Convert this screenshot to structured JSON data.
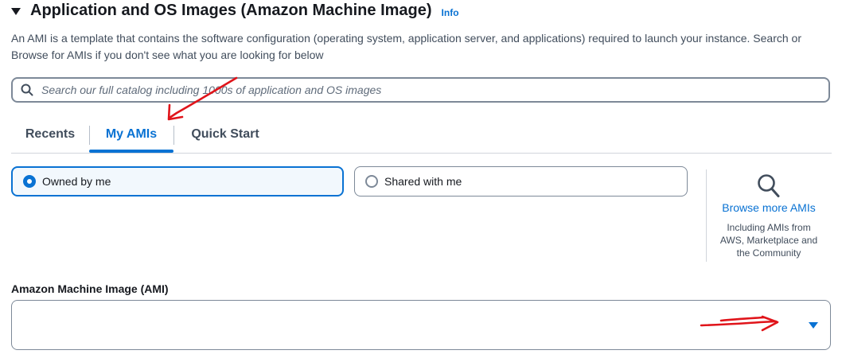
{
  "section": {
    "title": "Application and OS Images (Amazon Machine Image)",
    "info_link": "Info",
    "description": "An AMI is a template that contains the software configuration (operating system, application server, and applications) required to launch your instance. Search or Browse for AMIs if you don't see what you are looking for below"
  },
  "search": {
    "placeholder": "Search our full catalog including 1000s of application and OS images",
    "value": ""
  },
  "tabs": [
    {
      "label": "Recents",
      "selected": false
    },
    {
      "label": "My AMIs",
      "selected": true
    },
    {
      "label": "Quick Start",
      "selected": false
    }
  ],
  "ownership": {
    "options": [
      {
        "label": "Owned by me",
        "selected": true
      },
      {
        "label": "Shared with me",
        "selected": false
      }
    ]
  },
  "browse": {
    "link": "Browse more AMIs",
    "subtext_lines": [
      "Including AMIs from",
      "AWS, Marketplace and",
      "the Community"
    ]
  },
  "ami_field": {
    "label": "Amazon Machine Image (AMI)",
    "value": ""
  },
  "colors": {
    "accent": "#0972d3",
    "annotation": "#e0141a"
  }
}
